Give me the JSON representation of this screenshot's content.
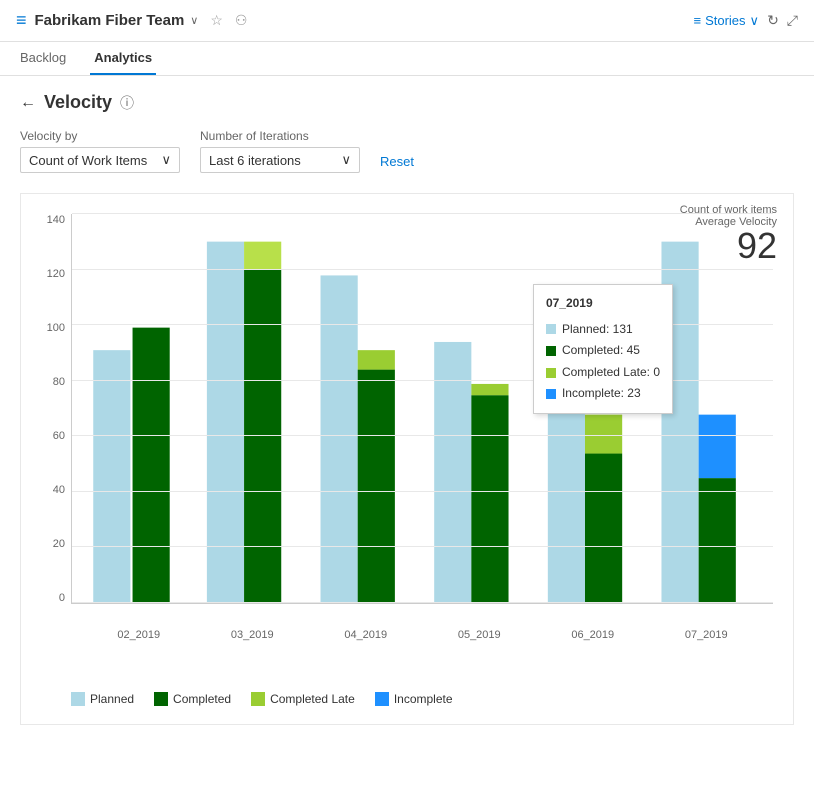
{
  "header": {
    "icon": "≡",
    "team_name": "Fabrikam Fiber Team",
    "chevron": "∨",
    "star": "☆",
    "people": "⚇",
    "stories_label": "Stories",
    "stories_chevron": "∨",
    "refresh": "↻",
    "expand": "⤢"
  },
  "nav": {
    "tabs": [
      {
        "label": "Backlog",
        "active": false
      },
      {
        "label": "Analytics",
        "active": true
      }
    ]
  },
  "page": {
    "back": "←",
    "title": "Velocity",
    "help": "ⓘ"
  },
  "filters": {
    "velocity_by_label": "Velocity by",
    "velocity_by_value": "Count of Work Items",
    "iterations_label": "Number of Iterations",
    "iterations_value": "Last 6 iterations",
    "reset_label": "Reset"
  },
  "chart": {
    "metric_label": "Count of work items",
    "avg_velocity_label": "Average Velocity",
    "avg_velocity_value": "92",
    "y_labels": [
      "140",
      "120",
      "100",
      "80",
      "60",
      "40",
      "20",
      "0"
    ],
    "x_labels": [
      "02_2019",
      "03_2019",
      "04_2019",
      "05_2019",
      "06_2019",
      "07_2019"
    ],
    "bars": [
      {
        "sprint": "02_2019",
        "planned": 91,
        "completed": 99,
        "completed_late": 0,
        "incomplete": 0
      },
      {
        "sprint": "03_2019",
        "planned": 130,
        "completed": 120,
        "completed_late": 0,
        "incomplete": 0
      },
      {
        "sprint": "04_2019",
        "planned": 118,
        "completed": 84,
        "completed_late": 7,
        "incomplete": 0
      },
      {
        "sprint": "05_2019",
        "planned": 94,
        "completed": 75,
        "completed_late": 4,
        "incomplete": 0
      },
      {
        "sprint": "06_2019",
        "planned": 91,
        "completed": 54,
        "completed_late": 14,
        "incomplete": 0
      },
      {
        "sprint": "07_2019",
        "planned": 130,
        "completed": 45,
        "completed_late": 0,
        "incomplete": 23
      }
    ],
    "tooltip": {
      "title": "07_2019",
      "rows": [
        {
          "color": "#add8e6",
          "label": "Planned: 131"
        },
        {
          "color": "#006400",
          "label": "Completed: 45"
        },
        {
          "color": "#9acd32",
          "label": "Completed Late: 0"
        },
        {
          "color": "#1e90ff",
          "label": "Incomplete: 23"
        }
      ]
    },
    "legend": [
      {
        "color": "#add8e6",
        "label": "Planned"
      },
      {
        "color": "#006400",
        "label": "Completed"
      },
      {
        "color": "#9acd32",
        "label": "Completed Late"
      },
      {
        "color": "#1e90ff",
        "label": "Incomplete"
      }
    ]
  }
}
